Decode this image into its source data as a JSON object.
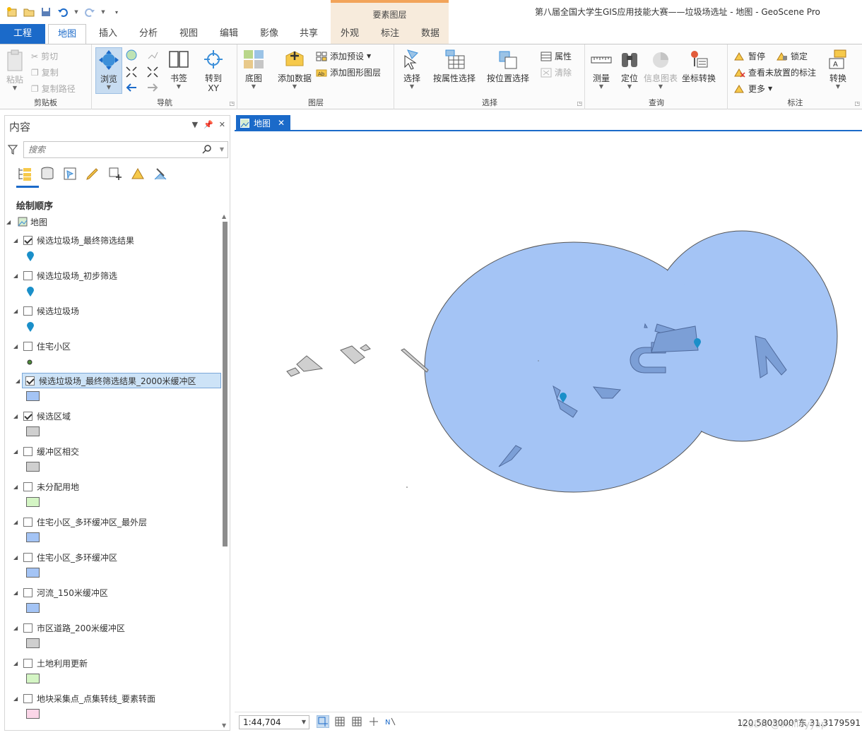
{
  "app": {
    "title": "第八届全国大学生GIS应用技能大赛——垃圾场选址 - 地图 - GeoScene Pro",
    "context_group": "要素图层"
  },
  "ribbon_tabs": [
    {
      "label": "工程"
    },
    {
      "label": "地图"
    },
    {
      "label": "插入"
    },
    {
      "label": "分析"
    },
    {
      "label": "视图"
    },
    {
      "label": "编辑"
    },
    {
      "label": "影像"
    },
    {
      "label": "共享"
    },
    {
      "label": "外观"
    },
    {
      "label": "标注"
    },
    {
      "label": "数据"
    }
  ],
  "ribbon": {
    "clipboard": {
      "label": "剪贴板",
      "paste": "粘贴",
      "cut": "剪切",
      "copy": "复制",
      "copy_path": "复制路径"
    },
    "navigate": {
      "label": "导航",
      "explore": "浏览",
      "bookmarks": "书签",
      "goto_xy_line1": "转到",
      "goto_xy_line2": "XY"
    },
    "layer": {
      "label": "图层",
      "basemap": "底图",
      "add_data": "添加数据",
      "add_preset": "添加预设",
      "add_graphics_layer": "添加图形图层"
    },
    "selection": {
      "label": "选择",
      "select": "选择",
      "select_by_attributes": "按属性选择",
      "select_by_location": "按位置选择",
      "attributes": "属性",
      "clear": "清除"
    },
    "inquiry": {
      "label": "查询",
      "measure": "测量",
      "locate": "定位",
      "infographics": "信息图表",
      "coordinate_conversion": "坐标转换"
    },
    "labeling": {
      "label": "标注",
      "pause": "暂停",
      "lock": "锁定",
      "view_unplaced": "查看未放置的标注",
      "more": "更多",
      "convert": "转换"
    }
  },
  "contents": {
    "title": "内容",
    "search_placeholder": "搜索",
    "draw_order_label": "绘制顺序",
    "map_name": "地图",
    "layers": [
      {
        "name": "候选垃圾场_最终筛选结果",
        "checked": true,
        "symbol": "pin",
        "color": "#1a8fc9"
      },
      {
        "name": "候选垃圾场_初步筛选",
        "checked": false,
        "symbol": "pin",
        "color": "#1a8fc9"
      },
      {
        "name": "候选垃圾场",
        "checked": false,
        "symbol": "pin",
        "color": "#1a8fc9"
      },
      {
        "name": "住宅小区",
        "checked": false,
        "symbol": "dot",
        "color": "#4e8a3a"
      },
      {
        "name": "候选垃圾场_最终筛选结果_2000米缓冲区",
        "checked": true,
        "symbol": "fill",
        "color": "#a4c4f5",
        "selected": true
      },
      {
        "name": "候选区域",
        "checked": true,
        "symbol": "fill",
        "color": "#cfcfcf"
      },
      {
        "name": "缓冲区相交",
        "checked": false,
        "symbol": "fill",
        "color": "#cfcfcf"
      },
      {
        "name": "未分配用地",
        "checked": false,
        "symbol": "fill",
        "color": "#d4f5c4"
      },
      {
        "name": "住宅小区_多环缓冲区_最外层",
        "checked": false,
        "symbol": "fill",
        "color": "#a4c4f5"
      },
      {
        "name": "住宅小区_多环缓冲区",
        "checked": false,
        "symbol": "fill",
        "color": "#a4c4f5"
      },
      {
        "name": "河流_150米缓冲区",
        "checked": false,
        "symbol": "fill",
        "color": "#a4c4f5"
      },
      {
        "name": "市区道路_200米缓冲区",
        "checked": false,
        "symbol": "fill",
        "color": "#cfcfcf"
      },
      {
        "name": "土地利用更新",
        "checked": false,
        "symbol": "fill",
        "color": "#d4f5c4"
      },
      {
        "name": "地块采集点_点集转线_要素转面",
        "checked": false,
        "symbol": "fill",
        "color": "#fbd6e8"
      }
    ]
  },
  "map_view": {
    "tab_label": "地图",
    "scale": "1:44,704",
    "coordinates": "120.5803000°东 31.3179591",
    "watermark": "CSDN @smileyyap"
  },
  "colors": {
    "accent": "#1b6ac9",
    "buffer_fill": "#a4c4f5",
    "candidate_fill": "#7c9fd6",
    "context_tab_bg": "#f7ebdc"
  }
}
